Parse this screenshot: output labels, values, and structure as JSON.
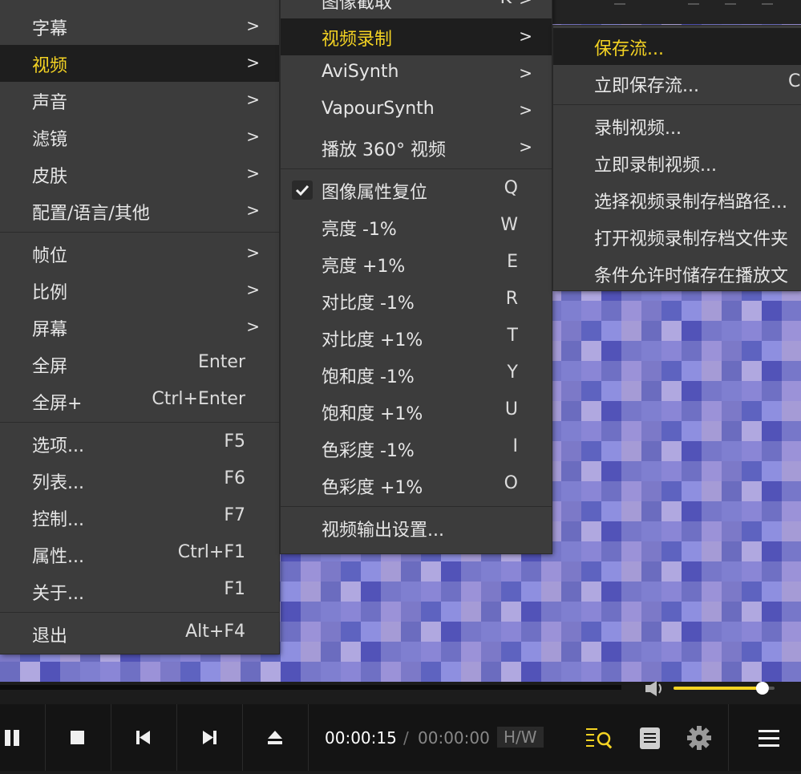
{
  "main_menu": {
    "items": [
      {
        "label": "字幕",
        "shortcut": "",
        "submenu": true
      },
      {
        "label": "视频",
        "shortcut": "",
        "submenu": true,
        "active": true
      },
      {
        "label": "声音",
        "shortcut": "",
        "submenu": true
      },
      {
        "label": "滤镜",
        "shortcut": "",
        "submenu": true
      },
      {
        "label": "皮肤",
        "shortcut": "",
        "submenu": true
      },
      {
        "label": "配置/语言/其他",
        "shortcut": "",
        "submenu": true
      },
      {
        "label": "帧位",
        "shortcut": "",
        "submenu": true
      },
      {
        "label": "比例",
        "shortcut": "",
        "submenu": true
      },
      {
        "label": "屏幕",
        "shortcut": "",
        "submenu": true
      },
      {
        "label": "全屏",
        "shortcut": "Enter",
        "submenu": false
      },
      {
        "label": "全屏+",
        "shortcut": "Ctrl+Enter",
        "submenu": false
      },
      {
        "label": "选项...",
        "shortcut": "F5",
        "submenu": false
      },
      {
        "label": "列表...",
        "shortcut": "F6",
        "submenu": false
      },
      {
        "label": "控制...",
        "shortcut": "F7",
        "submenu": false
      },
      {
        "label": "属性...",
        "shortcut": "Ctrl+F1",
        "submenu": false
      },
      {
        "label": "关于...",
        "shortcut": "F1",
        "submenu": false
      },
      {
        "label": "退出",
        "shortcut": "Alt+F4",
        "submenu": false
      }
    ]
  },
  "video_menu": {
    "items": [
      {
        "label": "图像截取",
        "shortcut": "K",
        "submenu": true
      },
      {
        "label": "视频录制",
        "shortcut": "",
        "submenu": true,
        "active": true
      },
      {
        "label": "AviSynth",
        "shortcut": "",
        "submenu": true
      },
      {
        "label": "VapourSynth",
        "shortcut": "",
        "submenu": true
      },
      {
        "label": "播放 360° 视频",
        "shortcut": "",
        "submenu": true
      },
      {
        "label": "图像属性复位",
        "shortcut": "Q",
        "submenu": false,
        "checked": true
      },
      {
        "label": "亮度 -1%",
        "shortcut": "W",
        "submenu": false
      },
      {
        "label": "亮度 +1%",
        "shortcut": "E",
        "submenu": false
      },
      {
        "label": "对比度 -1%",
        "shortcut": "R",
        "submenu": false
      },
      {
        "label": "对比度 +1%",
        "shortcut": "T",
        "submenu": false
      },
      {
        "label": "饱和度 -1%",
        "shortcut": "Y",
        "submenu": false
      },
      {
        "label": "饱和度 +1%",
        "shortcut": "U",
        "submenu": false
      },
      {
        "label": "色彩度 -1%",
        "shortcut": "I",
        "submenu": false
      },
      {
        "label": "色彩度 +1%",
        "shortcut": "O",
        "submenu": false
      },
      {
        "label": "视频输出设置...",
        "shortcut": "",
        "submenu": false
      }
    ]
  },
  "record_menu": {
    "items": [
      {
        "label": "保存流...",
        "shortcut": "",
        "active": true
      },
      {
        "label": "立即保存流...",
        "shortcut": "Ct"
      },
      {
        "label": "录制视频...",
        "shortcut": ""
      },
      {
        "label": "立即录制视频...",
        "shortcut": ""
      },
      {
        "label": "选择视频录制存档路径...",
        "shortcut": ""
      },
      {
        "label": "打开视频录制存档文件夹",
        "shortcut": ""
      },
      {
        "label": "条件允许时储存在播放文",
        "shortcut": ""
      }
    ]
  },
  "player": {
    "current_time": "00:00:15",
    "separator": "/",
    "total_time": "00:00:00",
    "hw_label": "H/W",
    "volume_fraction": 0.88
  },
  "colors": {
    "accent": "#f4d323",
    "menu_bg": "#3c3c3c",
    "active_bg": "#1e1e1e"
  }
}
